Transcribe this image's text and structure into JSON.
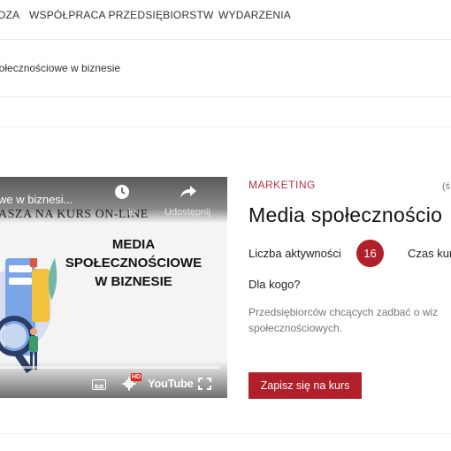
{
  "nav": {
    "items": [
      "OZA",
      "WSPÓŁPRACA PRZEDSIĘBIORSTW",
      "WYDARZENIA"
    ]
  },
  "breadcrumb": {
    "current": "połecznościowe w biznesie"
  },
  "video": {
    "title": "we w biznesi...",
    "promo_text": "ASZA NA KURS ON-LINE",
    "watch_later_label": "ie",
    "share_label": "Udostępnij",
    "graphic_title": "MEDIA\nSPOŁECZNOŚCIOWE\nW BIZNESIE",
    "youtube_logo": "YouTube",
    "hd_badge": "HD",
    "progress": 0.0
  },
  "course": {
    "category": "MARKETING",
    "paren": "(ś",
    "title": "Media społecznościo",
    "activities_label": "Liczba aktywności",
    "activities_count": "16",
    "time_label": "Czas kur",
    "for_who_label": "Dla kogo?",
    "description": "Przedsiębiorców chcących zadbać o wiz społecznościowych.",
    "cta_label": "Zapisz się na kurs"
  },
  "colors": {
    "accent": "#b01f2a",
    "category": "#b8323d"
  },
  "icons": [
    "clock-icon",
    "share-icon",
    "subtitles-icon",
    "settings-icon",
    "fullscreen-icon"
  ]
}
